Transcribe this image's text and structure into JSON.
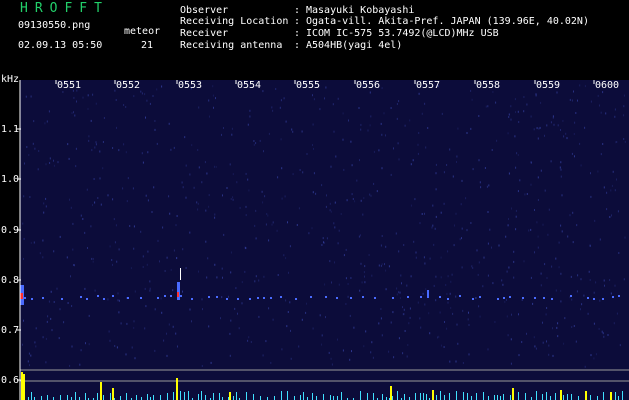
{
  "header": {
    "app_title": "HROFFT",
    "file_name": "09130550.png",
    "timestamp": "02.09.13 05:50",
    "meteor_label": "meteor",
    "meteor_count": "21"
  },
  "metadata": [
    {
      "label": "Observer",
      "value": "Masayuki Kobayashi"
    },
    {
      "label": "Receiving Location",
      "value": "Ogata-vill. Akita-Pref. JAPAN (139.96E, 40.02N)"
    },
    {
      "label": "Receiver",
      "value": "ICOM IC-575 53.7492(@LCD)MHz USB"
    },
    {
      "label": "Receiving antenna",
      "value": "A504HB(yagi 4el)"
    }
  ],
  "axis": {
    "unit": "kHz",
    "time_labels": [
      "0551",
      "0552",
      "0553",
      "0554",
      "0555",
      "0556",
      "0557",
      "0558",
      "0559",
      "0600"
    ],
    "freq_labels": [
      "1.1",
      "1.0",
      "0.9",
      "0.8",
      "0.7",
      "0.6"
    ]
  },
  "colors": {
    "background": "#000000",
    "spectrogram_bg": "#0c0c3a",
    "echo_blue": "#4a6bff",
    "echo_red": "#ff3030",
    "bar_yellow": "#ffff00",
    "bar_cyan": "#40e0ff",
    "title_green": "#22d06a"
  }
}
